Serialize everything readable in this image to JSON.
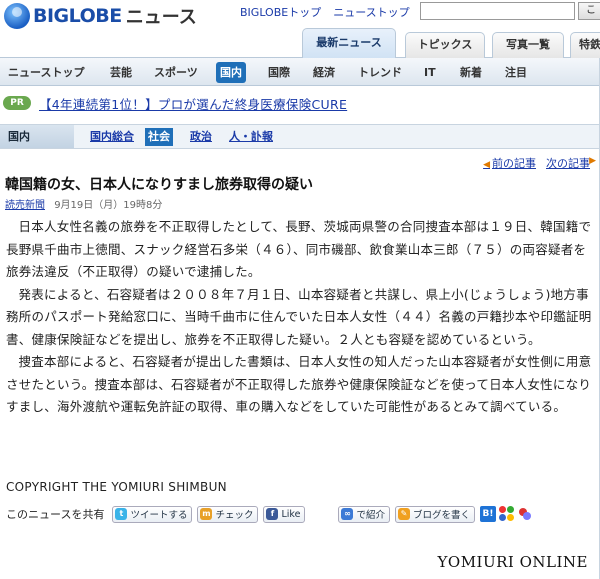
{
  "header": {
    "logo_text": "BIGLOBE",
    "logo_sub": "ニュース",
    "links": [
      "BIGLOBEトップ",
      "ニューストップ"
    ],
    "search_button": "こ"
  },
  "tabs": [
    {
      "label": "最新ニュース",
      "active": true
    },
    {
      "label": "トピックス",
      "active": false
    },
    {
      "label": "写真一覧",
      "active": false
    },
    {
      "label": "特鉄",
      "active": false
    }
  ],
  "categories": [
    {
      "label": "ニューストップ",
      "active": false
    },
    {
      "label": "芸能",
      "active": false
    },
    {
      "label": "スポーツ",
      "active": false
    },
    {
      "label": "国内",
      "active": true
    },
    {
      "label": "国際",
      "active": false
    },
    {
      "label": "経済",
      "active": false
    },
    {
      "label": "トレンド",
      "active": false
    },
    {
      "label": "IT",
      "active": false
    },
    {
      "label": "新着",
      "active": false
    },
    {
      "label": "注目",
      "active": false
    }
  ],
  "pr": {
    "badge": "PR",
    "text": "【4年連続第1位！】プロが選んだ終身医療保険CURE"
  },
  "subnav": {
    "head": "国内",
    "items": [
      {
        "label": "国内総合",
        "active": false
      },
      {
        "label": "社会",
        "active": true
      },
      {
        "label": "政治",
        "active": false
      },
      {
        "label": "人・訃報",
        "active": false
      }
    ]
  },
  "article_nav": {
    "prev": "前の記事",
    "next": "次の記事"
  },
  "article": {
    "title": "韓国籍の女、日本人になりすまし旅券取得の疑い",
    "source": "読売新聞",
    "date": "9月19日（月）19時8分",
    "paragraphs": [
      "日本人女性名義の旅券を不正取得したとして、長野、茨城両県警の合同捜査本部は１９日、韓国籍で長野県千曲市上徳間、スナック経営石多栄（４６）、同市磯部、飲食業山本三郎（７５）の両容疑者を旅券法違反（不正取得）の疑いで逮捕した。",
      "発表によると、石容疑者は２００８年７月１日、山本容疑者と共謀し、県上小(じょうしょう)地方事務所のパスポート発給窓口に、当時千曲市に住んでいた日本人女性（４４）名義の戸籍抄本や印鑑証明書、健康保険証などを提出し、旅券を不正取得した疑い。２人とも容疑を認めているという。",
      "捜査本部によると、石容疑者が提出した書類は、日本人女性の知人だった山本容疑者が女性側に用意させたという。捜査本部は、石容疑者が不正取得した旅券や健康保険証などを使って日本人女性になりすまし、海外渡航や運転免許証の取得、車の購入などをしていた可能性があるとみて調べている。"
    ],
    "copyright": "COPYRIGHT THE YOMIURI SHIMBUN"
  },
  "share": {
    "label": "このニュースを共有",
    "twitter": "ツイートする",
    "mixi": "チェック",
    "facebook": "Like",
    "intro": "で紹介",
    "blog": "ブログを書く",
    "hatena": "B!"
  },
  "footer": {
    "brand": "YOMIURI ONLINE"
  },
  "colors": {
    "link": "#1a3aa8",
    "active_nav": "#1f6fb8",
    "pr_badge": "#6aa84f"
  }
}
